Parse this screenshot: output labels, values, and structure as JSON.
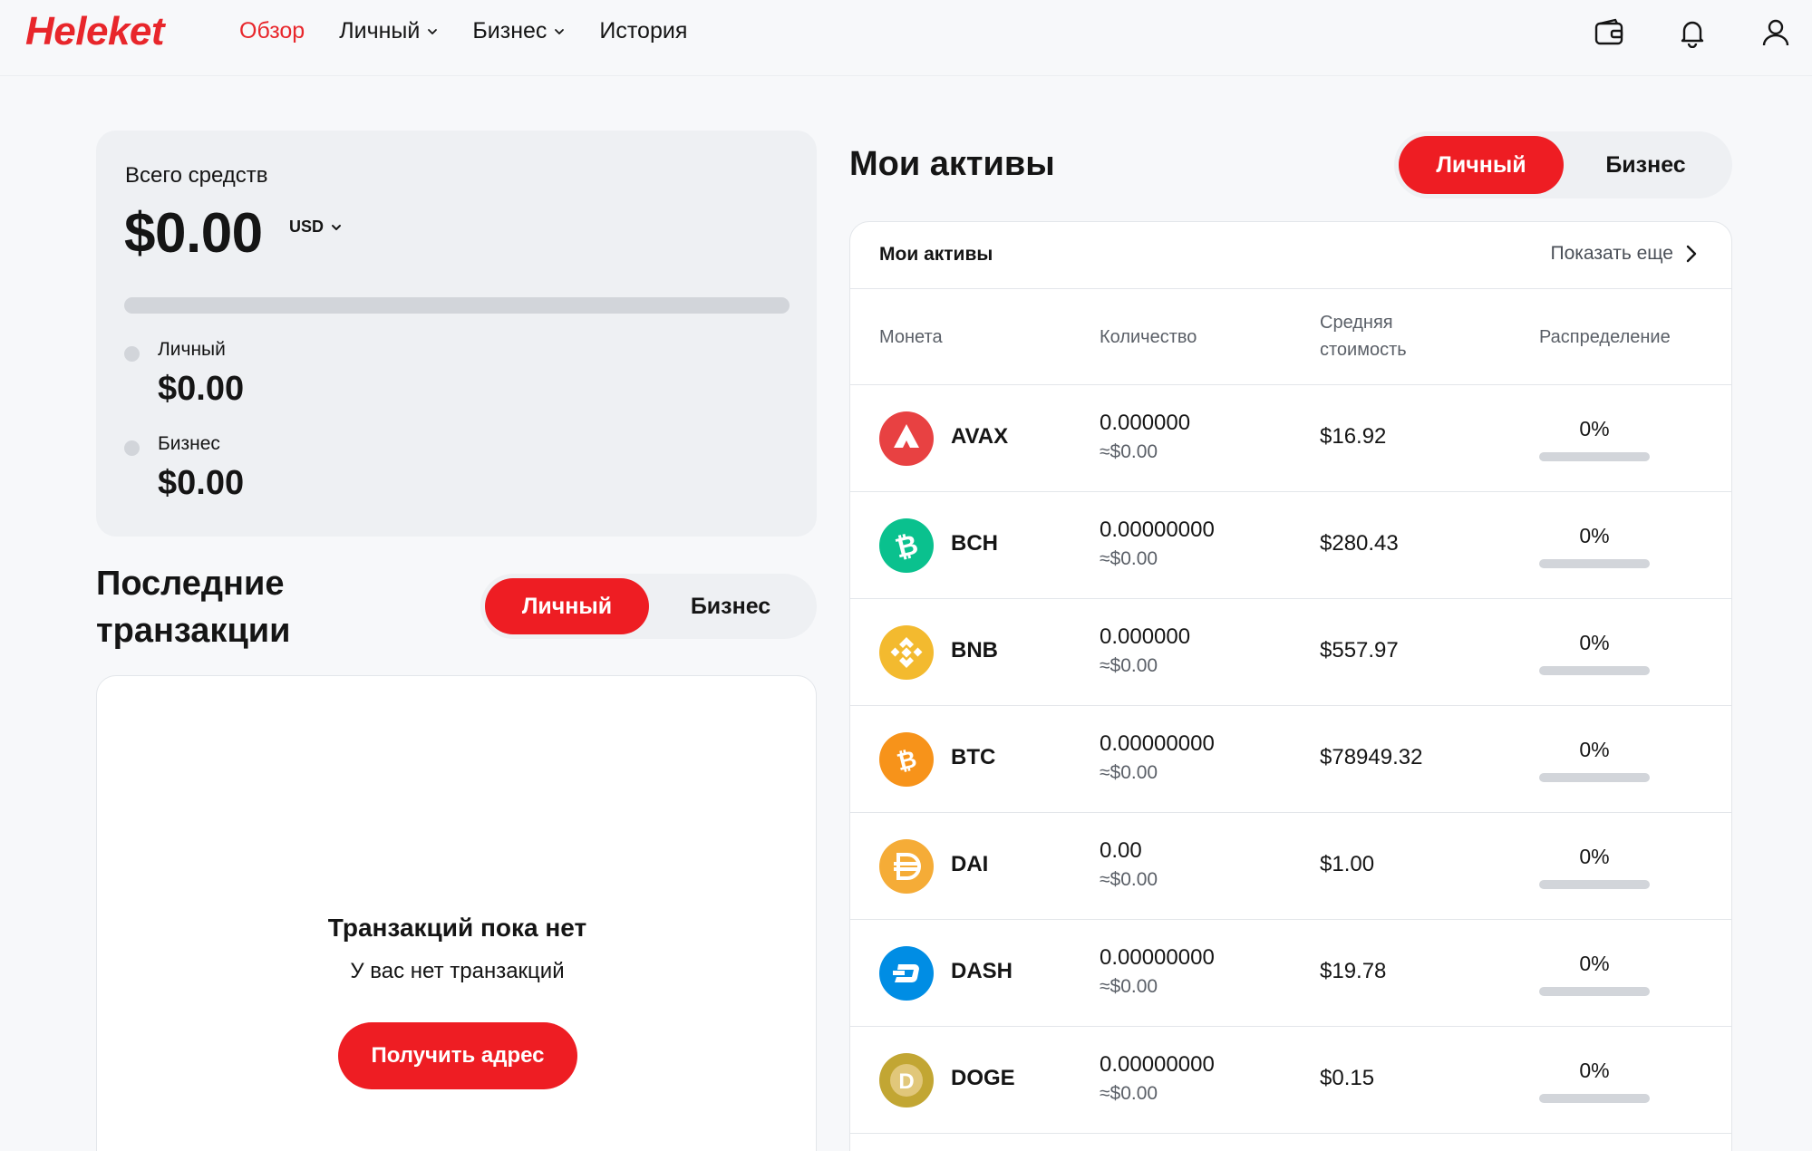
{
  "header": {
    "logo": "Heleket",
    "nav": [
      {
        "label": "Обзор",
        "active": true,
        "dropdown": false
      },
      {
        "label": "Личный",
        "active": false,
        "dropdown": true
      },
      {
        "label": "Бизнес",
        "active": false,
        "dropdown": true
      },
      {
        "label": "История",
        "active": false,
        "dropdown": false
      }
    ],
    "icons": [
      "wallet-icon",
      "bell-icon",
      "user-icon"
    ]
  },
  "balance": {
    "title": "Всего средств",
    "total": "$0.00",
    "currency": "USD",
    "personal_share": 0,
    "personal_label": "Личный",
    "personal_value": "$0.00",
    "business_label": "Бизнес",
    "business_value": "$0.00"
  },
  "transactions": {
    "title": "Последние транзакции",
    "toggle": {
      "personal": "Личный",
      "business": "Бизнес",
      "selected": "personal"
    },
    "empty_title": "Транзакций пока нет",
    "empty_subtitle": "У вас нет транзакций",
    "cta_label": "Получить адрес"
  },
  "assets": {
    "title": "Мои активы",
    "toggle": {
      "personal": "Личный",
      "business": "Бизнес",
      "selected": "personal"
    },
    "panel_title": "Мои активы",
    "show_more": "Показать еще",
    "columns": {
      "coin": "Монета",
      "quantity": "Количество",
      "avg_cost": "Средняя стоимость",
      "distribution": "Распределение"
    },
    "rows": [
      {
        "symbol": "AVAX",
        "quantity": "0.000000",
        "quantity_usd": "≈$0.00",
        "avg_cost": "$16.92",
        "distribution": "0%",
        "distribution_value": 0,
        "color": "#e84142",
        "icon": "avax-icon"
      },
      {
        "symbol": "BCH",
        "quantity": "0.00000000",
        "quantity_usd": "≈$0.00",
        "avg_cost": "$280.43",
        "distribution": "0%",
        "distribution_value": 0,
        "color": "#0ac18e",
        "icon": "bch-icon"
      },
      {
        "symbol": "BNB",
        "quantity": "0.000000",
        "quantity_usd": "≈$0.00",
        "avg_cost": "$557.97",
        "distribution": "0%",
        "distribution_value": 0,
        "color": "#f3ba2f",
        "icon": "bnb-icon"
      },
      {
        "symbol": "BTC",
        "quantity": "0.00000000",
        "quantity_usd": "≈$0.00",
        "avg_cost": "$78949.32",
        "distribution": "0%",
        "distribution_value": 0,
        "color": "#f7931a",
        "icon": "btc-icon"
      },
      {
        "symbol": "DAI",
        "quantity": "0.00",
        "quantity_usd": "≈$0.00",
        "avg_cost": "$1.00",
        "distribution": "0%",
        "distribution_value": 0,
        "color": "#f5ac37",
        "icon": "dai-icon"
      },
      {
        "symbol": "DASH",
        "quantity": "0.00000000",
        "quantity_usd": "≈$0.00",
        "avg_cost": "$19.78",
        "distribution": "0%",
        "distribution_value": 0,
        "color": "#008de4",
        "icon": "dash-icon"
      },
      {
        "symbol": "DOGE",
        "quantity": "0.00000000",
        "quantity_usd": "≈$0.00",
        "avg_cost": "$0.15",
        "distribution": "0%",
        "distribution_value": 0,
        "color": "#c2a633",
        "icon": "doge-icon"
      }
    ]
  },
  "colors": {
    "accent": "#ee1d23",
    "brand": "#e8262b",
    "card": "#eef0f3",
    "bar": "#d2d5da"
  }
}
